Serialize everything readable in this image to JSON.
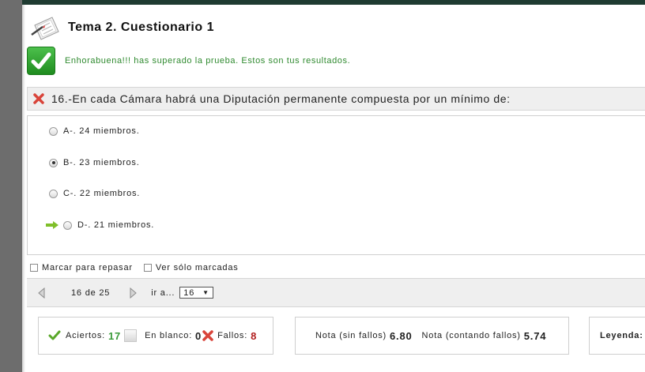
{
  "header": {
    "title": "Tema 2. Cuestionario 1",
    "icon": "exam-paper-icon"
  },
  "result": {
    "message": "Enhorabuena!!! has superado la prueba. Estos son tus resultados.",
    "icon": "checkmark-icon",
    "color": "#2f8a2f"
  },
  "question": {
    "text": "16.-En cada Cámara habrá una Diputación permanente compuesta por un mínimo de:",
    "status_icon": "wrong-x-icon",
    "options": [
      {
        "label": "A-. 24 miembros.",
        "selected": false,
        "correct": false
      },
      {
        "label": "B-. 23 miembros.",
        "selected": true,
        "correct": false
      },
      {
        "label": "C-. 22 miembros.",
        "selected": false,
        "correct": false
      },
      {
        "label": "D-. 21 miembros.",
        "selected": false,
        "correct": true
      }
    ]
  },
  "checks": {
    "mark_label": "Marcar para repasar",
    "view_label": "Ver sólo marcadas"
  },
  "nav": {
    "position": "16 de 25",
    "goto_label": "ir a...",
    "goto_value": "16"
  },
  "stats": {
    "aciertos_label": "Aciertos:",
    "aciertos_value": "17",
    "blanco_label": "En blanco:",
    "blanco_value": "0",
    "fallos_label": "Fallos:",
    "fallos_value": "8"
  },
  "grades": {
    "sin_fallos_label": "Nota (sin fallos)",
    "sin_fallos_value": "6.80",
    "con_fallos_label": "Nota (contando fallos)",
    "con_fallos_value": "5.74"
  },
  "legend": {
    "label": "Leyenda:"
  }
}
